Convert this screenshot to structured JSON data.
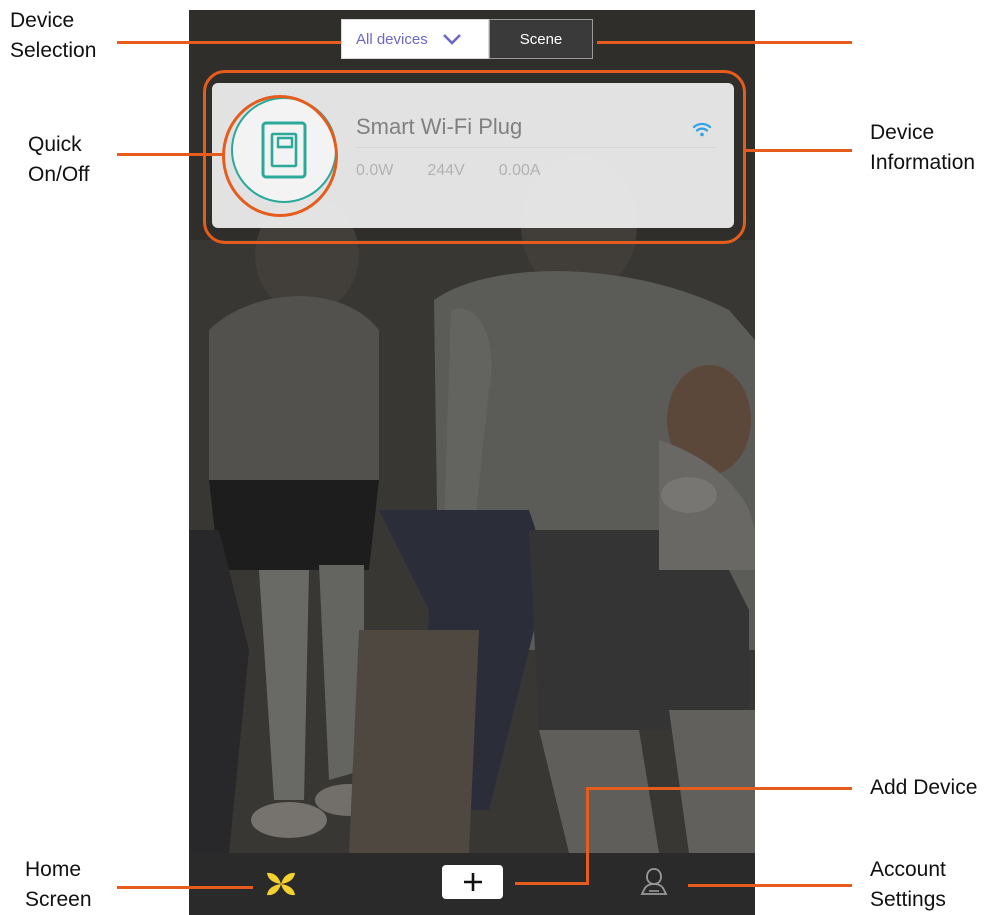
{
  "segmented": {
    "all_devices_label": "All devices",
    "scene_label": "Scene"
  },
  "device": {
    "name": "Smart Wi-Fi Plug",
    "power": "0.0W",
    "voltage": "244V",
    "current": "0.00A",
    "wifi_icon": "wifi-icon",
    "switch_icon": "switch-icon"
  },
  "tabbar": {
    "home_icon": "home-icon",
    "add_icon": "plus-icon",
    "account_icon": "account-icon"
  },
  "annotations": {
    "device_selection": [
      "Device",
      "Selection"
    ],
    "quick_onoff": [
      "Quick",
      "On/Off"
    ],
    "device_information": [
      "Device",
      "Information"
    ],
    "add_device": "Add Device",
    "home_screen": [
      "Home",
      "Screen"
    ],
    "account_settings": [
      "Account",
      "Settings"
    ]
  },
  "colors": {
    "accent_orange": "#e65c1c",
    "teal": "#2aa89a",
    "home_yellow": "#f4d130",
    "wifi_blue": "#2aa3e8",
    "segment_text": "#6a68c8"
  }
}
